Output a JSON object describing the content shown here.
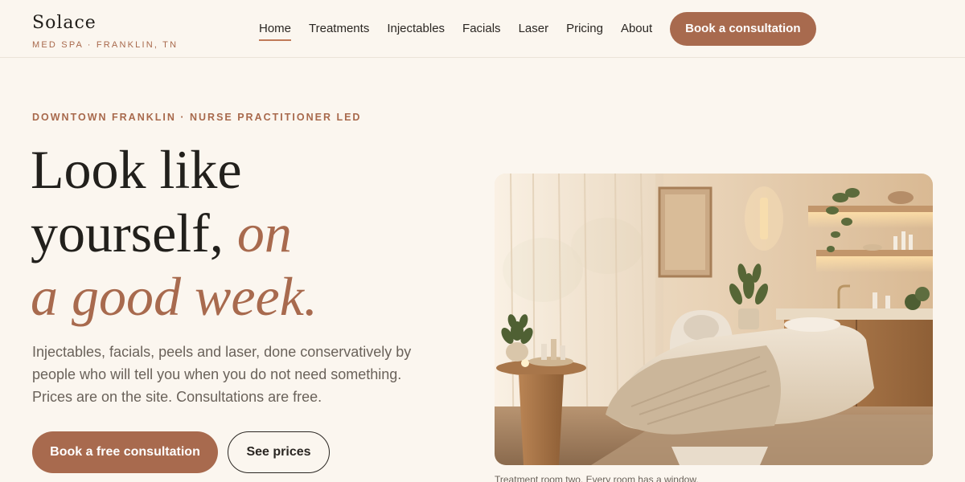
{
  "brand": {
    "name": "Solace",
    "tagline": "MED SPA · FRANKLIN, TN"
  },
  "nav": {
    "items": [
      {
        "label": "Home",
        "active": true
      },
      {
        "label": "Treatments"
      },
      {
        "label": "Injectables"
      },
      {
        "label": "Facials"
      },
      {
        "label": "Laser"
      },
      {
        "label": "Pricing"
      },
      {
        "label": "About"
      }
    ],
    "cta_label": "Book a consultation"
  },
  "hero": {
    "eyebrow": "DOWNTOWN FRANKLIN · NURSE PRACTITIONER LED",
    "headline_line1": "Look like",
    "headline_line2": "yourself,",
    "headline_accent1": "on",
    "headline_accent2": "a good week.",
    "lede": "Injectables, facials, peels and laser, done conservatively by people who will tell you when you do not need something. Prices are on the site. Consultations are free.",
    "primary_cta": "Book a free consultation",
    "secondary_cta": "See prices",
    "image_caption": "Treatment room two. Every room has a window."
  },
  "colors": {
    "background": "#fbf6ef",
    "accent": "#a86a4e",
    "text": "#22201c",
    "muted": "#6a625a"
  }
}
